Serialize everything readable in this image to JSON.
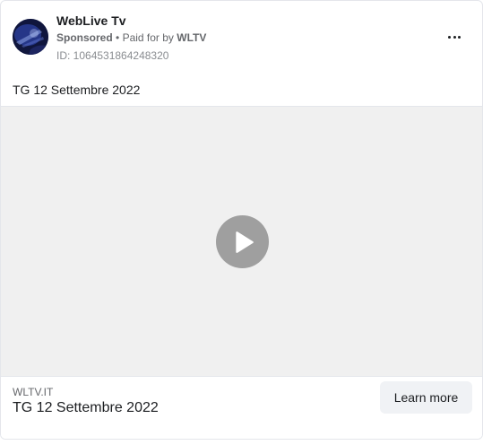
{
  "header": {
    "page_name": "WebLive Tv",
    "sponsored": "Sponsored",
    "separator": "•",
    "paid_for_by_label": "Paid for by",
    "payer": "WLTV",
    "ad_id": "ID: 1064531864248320",
    "more_icon": "more-horizontal-icon"
  },
  "post": {
    "text": "TG 12 Settembre 2022"
  },
  "video": {
    "play_icon": "play-icon",
    "background_color": "#f0f0f0",
    "play_color": "#9f9f9f"
  },
  "footer": {
    "domain": "WLTV.IT",
    "headline": "TG 12 Settembre 2022",
    "cta_label": "Learn more"
  }
}
